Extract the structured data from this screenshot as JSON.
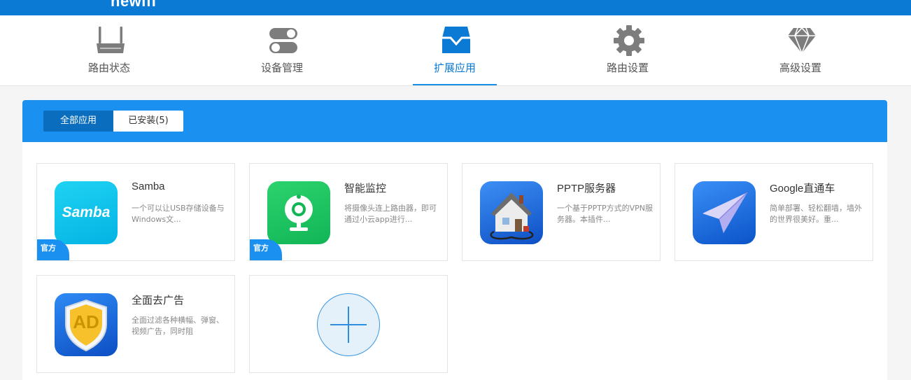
{
  "brand": {
    "name": "newifi"
  },
  "nav": {
    "items": [
      {
        "label": "路由状态",
        "icon": "router-icon"
      },
      {
        "label": "设备管理",
        "icon": "toggle-switches-icon"
      },
      {
        "label": "扩展应用",
        "icon": "inbox-tray-icon",
        "active": true
      },
      {
        "label": "路由设置",
        "icon": "gear-icon"
      },
      {
        "label": "高级设置",
        "icon": "diamond-icon"
      }
    ]
  },
  "tabs": {
    "all": "全部应用",
    "installed": "已安装(5)"
  },
  "apps": [
    {
      "name": "Samba",
      "desc": "一个可以让USB存储设备与Windows文...",
      "badge": "官方",
      "icon_text": "Samba"
    },
    {
      "name": "智能监控",
      "desc": "将摄像头连上路由器，即可通过小云app进行...",
      "badge": "官方"
    },
    {
      "name": "PPTP服务器",
      "desc": "一个基于PPTP方式的VPN服务器。本插件..."
    },
    {
      "name": "Google直通车",
      "desc": "简单部署、轻松翻墙，墙外的世界很美好。重..."
    },
    {
      "name": "全面去广告",
      "desc": "全面过滤各种横幅、弹窗、视频广告，同时阻",
      "icon_text": "AD"
    }
  ],
  "colors": {
    "topbar": "#0a7ad5",
    "accent": "#1a90f0",
    "active_tab": "#0a6dbd"
  }
}
